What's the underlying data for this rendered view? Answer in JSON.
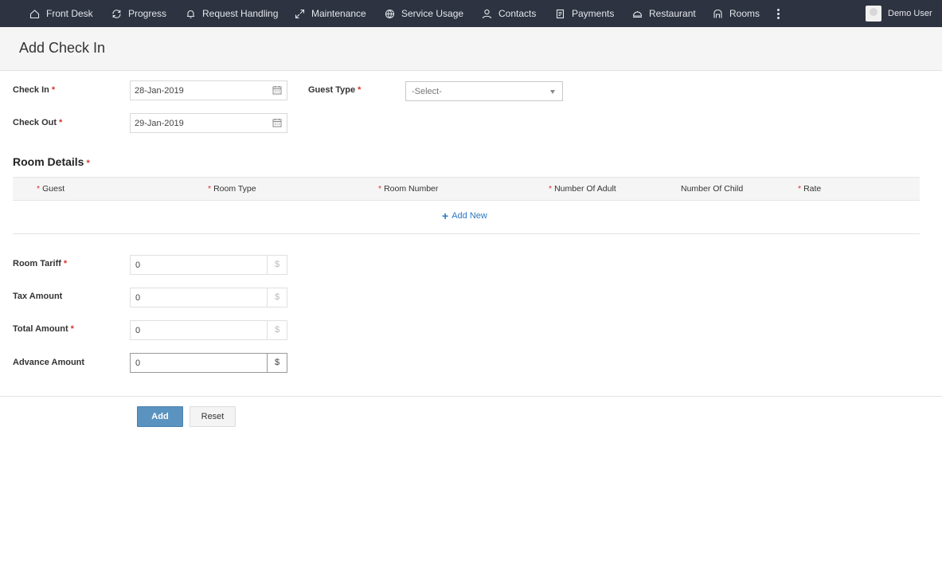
{
  "nav": {
    "items": [
      {
        "label": "Front Desk",
        "icon": "home-icon"
      },
      {
        "label": "Progress",
        "icon": "refresh-icon"
      },
      {
        "label": "Request Handling",
        "icon": "bell-icon"
      },
      {
        "label": "Maintenance",
        "icon": "expand-arrows-icon"
      },
      {
        "label": "Service Usage",
        "icon": "globe-icon"
      },
      {
        "label": "Contacts",
        "icon": "person-icon"
      },
      {
        "label": "Payments",
        "icon": "receipt-icon"
      },
      {
        "label": "Restaurant",
        "icon": "dish-icon"
      },
      {
        "label": "Rooms",
        "icon": "room-icon"
      }
    ],
    "more_icon": "more-vertical-icon",
    "user_name": "Demo User"
  },
  "header": {
    "title": "Add Check In"
  },
  "form": {
    "check_in": {
      "label": "Check In",
      "required": "*",
      "value": "28-Jan-2019"
    },
    "check_out": {
      "label": "Check Out",
      "required": "*",
      "value": "29-Jan-2019"
    },
    "guest_type": {
      "label": "Guest Type",
      "required": "*",
      "value": "-Select-"
    }
  },
  "room_details": {
    "title": "Room Details",
    "required": "*",
    "columns": [
      {
        "label": "Guest",
        "required": "*"
      },
      {
        "label": "Room Type",
        "required": "*"
      },
      {
        "label": "Room Number",
        "required": "*"
      },
      {
        "label": "Number Of Adult",
        "required": "*"
      },
      {
        "label": "Number Of Child",
        "required": ""
      },
      {
        "label": "Rate",
        "required": "*"
      }
    ],
    "add_new_label": "Add New"
  },
  "amounts": {
    "currency": "$",
    "room_tariff": {
      "label": "Room Tariff",
      "required": "*",
      "value": "0"
    },
    "tax_amount": {
      "label": "Tax Amount",
      "required": "",
      "value": "0"
    },
    "total_amount": {
      "label": "Total Amount",
      "required": "*",
      "value": "0"
    },
    "advance_amount": {
      "label": "Advance Amount",
      "required": "",
      "value": "0"
    }
  },
  "actions": {
    "add_label": "Add",
    "reset_label": "Reset"
  },
  "colors": {
    "nav_bg": "#2d3340",
    "primary": "#5b93c0",
    "link": "#2b78c2",
    "required": "#d9342b"
  }
}
